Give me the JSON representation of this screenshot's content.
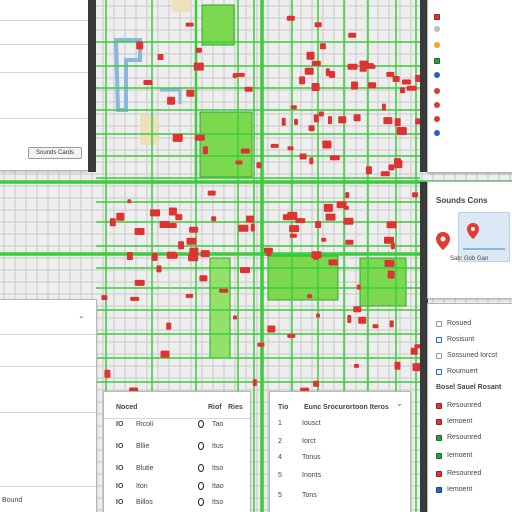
{
  "map": {
    "colors": {
      "background": "#eeeeee",
      "minor_road": "#c8c8c8",
      "route": "#3ccc3c",
      "marker": "#dd3333",
      "park": "#7cd84e",
      "water": "#8ab7dd",
      "sand": "#ece1b8"
    },
    "overlay_labels": [
      "",
      "",
      "",
      "",
      ""
    ]
  },
  "panels": {
    "top_left": {
      "rows": [
        "",
        "",
        "",
        "",
        "",
        ""
      ],
      "button_label": "Sounds Cards"
    },
    "top_right_legend": {
      "items": [
        "",
        "",
        "",
        "",
        "",
        "",
        "",
        ""
      ]
    },
    "mid_right": {
      "title": "Sounds Cons",
      "icon": "map-pin-icon",
      "footer": "Sab: Gob Gan"
    },
    "left_lower": {
      "rows": [
        "",
        "",
        "",
        "",
        "",
        "",
        "",
        "",
        ""
      ],
      "footer_label": "Bound"
    },
    "bottom_table": {
      "headers": [
        "Noced",
        "Riof",
        "Ries"
      ],
      "rows": [
        {
          "code": "IO",
          "name": "Ricoli",
          "val": "Tao"
        },
        {
          "code": "IO",
          "name": "Bllie",
          "val": "Itus"
        },
        {
          "code": "IO",
          "name": "Blutie",
          "val": "Itso"
        },
        {
          "code": "IO",
          "name": "Iton",
          "val": "Itao"
        },
        {
          "code": "IO",
          "name": "Billos",
          "val": "Itso"
        }
      ]
    },
    "bottom_list": {
      "header": {
        "num": "Tio",
        "title": "Eunc Srocurortoon Iteros"
      },
      "rows": [
        {
          "num": "1",
          "label": "Iousct"
        },
        {
          "num": "2",
          "label": "Iorct"
        },
        {
          "num": "4",
          "label": "Tonus"
        },
        {
          "num": "5",
          "label": "Inonts"
        },
        {
          "num": "5",
          "label": "Tons"
        }
      ]
    },
    "bottom_right": {
      "header": "Bosel Sauel Rosant",
      "items": [
        "Rosued",
        "Rosisunt",
        "Sossuned Iorcst",
        "Roumuert",
        "Resounred",
        "Iemoent"
      ]
    }
  }
}
